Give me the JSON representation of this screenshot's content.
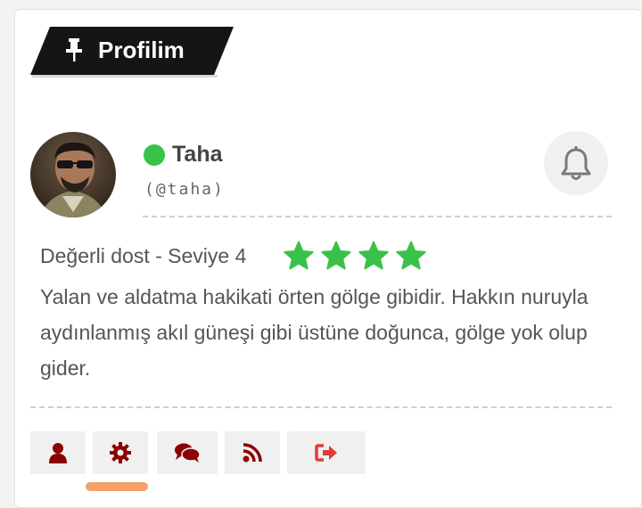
{
  "header": {
    "title": "Profilim",
    "icon": "pin-icon"
  },
  "profile": {
    "name": "Taha",
    "handle": "(@taha)",
    "status_color": "#39c24a",
    "notification_icon": "bell-icon"
  },
  "level": {
    "label": "Değerli dost - Seviye 4",
    "stars": 4,
    "star_color": "#39c24a"
  },
  "bio": "Yalan ve aldatma hakikati örten gölge gibidir. Hakkın nuruyla aydınlanmış akıl güneşi gibi üstüne doğunca, gölge yok olup gider.",
  "toolbar": {
    "buttons": [
      "user-icon",
      "gear-icon",
      "comments-icon",
      "rss-icon",
      "sign-out-icon"
    ],
    "active_color": "#8b0000",
    "logout_color": "#e23b3b"
  }
}
